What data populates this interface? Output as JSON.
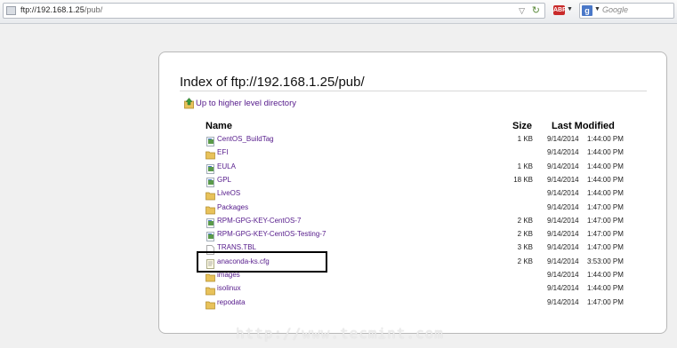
{
  "browser": {
    "url_host": "ftp://192.168.1.25",
    "url_path": "/pub/",
    "search_placeholder": "Google",
    "addon_badge": "ABP"
  },
  "page": {
    "title": "Index of ftp://192.168.1.25/pub/",
    "up_link": "Up to higher level directory",
    "columns": {
      "name": "Name",
      "size": "Size",
      "modified": "Last Modified"
    }
  },
  "files": [
    {
      "name": "CentOS_BuildTag",
      "type": "file",
      "size": "1 KB",
      "date": "9/14/2014",
      "time": "1:44:00 PM"
    },
    {
      "name": "EFI",
      "type": "folder",
      "size": "",
      "date": "9/14/2014",
      "time": "1:44:00 PM"
    },
    {
      "name": "EULA",
      "type": "file",
      "size": "1 KB",
      "date": "9/14/2014",
      "time": "1:44:00 PM"
    },
    {
      "name": "GPL",
      "type": "file",
      "size": "18 KB",
      "date": "9/14/2014",
      "time": "1:44:00 PM"
    },
    {
      "name": "LiveOS",
      "type": "folder",
      "size": "",
      "date": "9/14/2014",
      "time": "1:44:00 PM"
    },
    {
      "name": "Packages",
      "type": "folder",
      "size": "",
      "date": "9/14/2014",
      "time": "1:47:00 PM"
    },
    {
      "name": "RPM-GPG-KEY-CentOS-7",
      "type": "file",
      "size": "2 KB",
      "date": "9/14/2014",
      "time": "1:47:00 PM"
    },
    {
      "name": "RPM-GPG-KEY-CentOS-Testing-7",
      "type": "file",
      "size": "2 KB",
      "date": "9/14/2014",
      "time": "1:47:00 PM"
    },
    {
      "name": "TRANS.TBL",
      "type": "blank",
      "size": "3 KB",
      "date": "9/14/2014",
      "time": "1:47:00 PM"
    },
    {
      "name": "anaconda-ks.cfg",
      "type": "text",
      "size": "2 KB",
      "date": "9/14/2014",
      "time": "3:53:00 PM"
    },
    {
      "name": "images",
      "type": "folder",
      "size": "",
      "date": "9/14/2014",
      "time": "1:44:00 PM"
    },
    {
      "name": "isolinux",
      "type": "folder",
      "size": "",
      "date": "9/14/2014",
      "time": "1:44:00 PM"
    },
    {
      "name": "repodata",
      "type": "folder",
      "size": "",
      "date": "9/14/2014",
      "time": "1:47:00 PM"
    }
  ],
  "watermark": "http://www.tecmint.com",
  "colors": {
    "link": "#551a8b",
    "folder": "#e8c25a",
    "highlight_border": "#000000"
  }
}
